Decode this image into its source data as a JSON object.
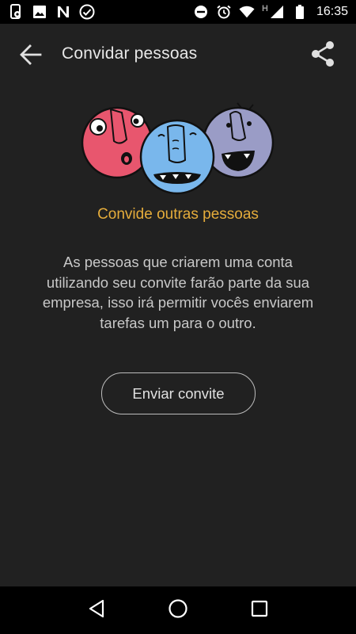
{
  "status_bar": {
    "time": "16:35",
    "network_type": "H",
    "icons_left": [
      "phone-settings-icon",
      "image-icon",
      "n-app-icon",
      "check-circle-icon"
    ],
    "icons_right": [
      "do-not-disturb-icon",
      "alarm-icon",
      "wifi-icon",
      "signal-icon",
      "battery-icon"
    ]
  },
  "app_bar": {
    "title": "Convidar pessoas",
    "back_icon": "arrow-back-icon",
    "share_icon": "share-icon"
  },
  "content": {
    "headline": "Convide outras pessoas",
    "description": "As pessoas que criarem uma conta utilizando seu convite farão parte da sua empresa, isso irá permitir vocês enviarem tarefas um para o outro.",
    "invite_button": "Enviar convite"
  },
  "colors": {
    "background": "#212121",
    "accent": "#e5ac3b",
    "face_red": "#e8566e",
    "face_blue": "#79b7ec",
    "face_purple": "#9a9cc6"
  },
  "nav_bar": {
    "buttons": [
      "back-triangle-icon",
      "home-circle-icon",
      "recents-square-icon"
    ]
  }
}
